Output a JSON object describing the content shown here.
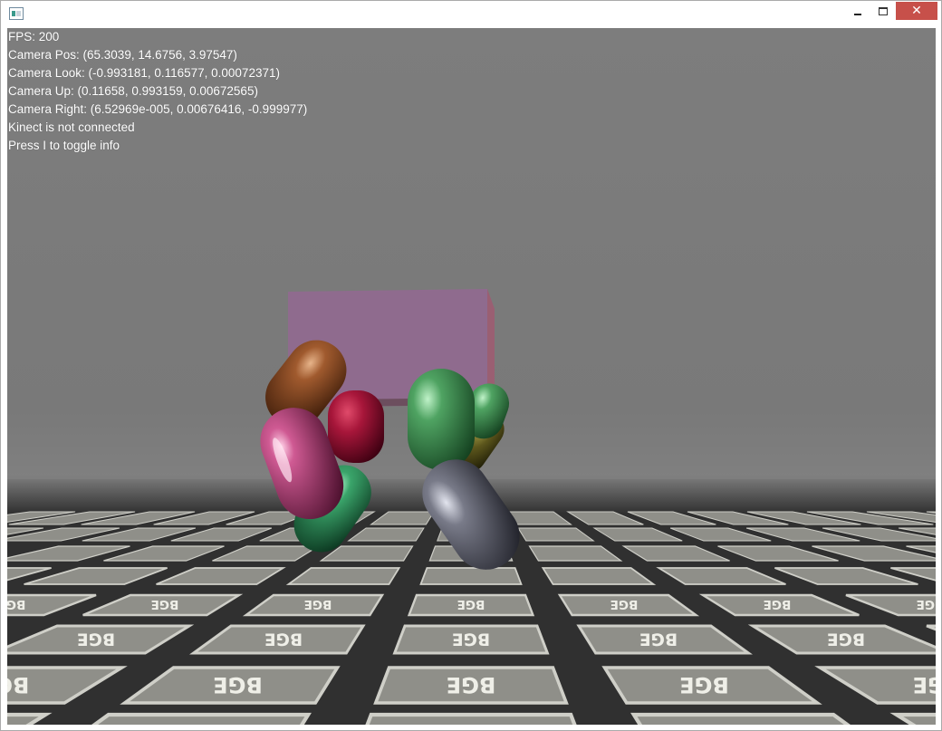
{
  "window": {
    "title": "",
    "controls": {
      "minimize": "minimize-icon",
      "maximize": "maximize-icon",
      "close": "close-icon",
      "close_glyph": "✕"
    }
  },
  "overlay": {
    "lines": [
      "FPS: 200",
      "Camera Pos: (65.3039, 14.6756, 3.97547)",
      "Camera Look: (-0.993181, 0.116577, 0.00072371)",
      "Camera Up: (0.11658, 0.993159, 0.00672565)",
      "Camera Right: (6.52969e-005, 0.00676416, -0.999977)",
      "Kinect is not connected",
      "Press I to toggle info"
    ]
  },
  "scene": {
    "floor_texture_text": "BGE",
    "colors": {
      "sky": "#7c7c7c",
      "floor_dark": "#2f2f2f",
      "tile": "#8e8e88",
      "box": "#8e6a8c",
      "capsule_brown": "#8a4a26",
      "capsule_pink": "#c2457e",
      "capsule_red": "#b01a3a",
      "capsule_green": "#4f9a62",
      "capsule_teal": "#3da36a",
      "capsule_olive": "#5f5a1e",
      "capsule_grey": "#6c6e7c"
    }
  }
}
